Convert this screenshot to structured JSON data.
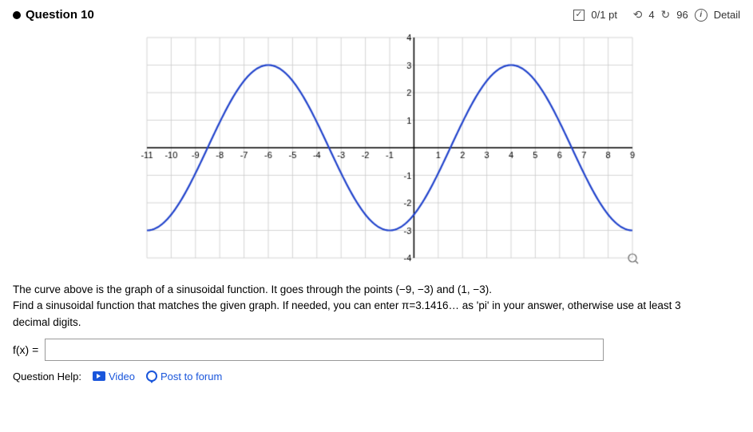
{
  "question": {
    "number": "Question 10",
    "score": "0/1 pt",
    "history_count": "4",
    "redo_count": "96",
    "detail_label": "Detail",
    "description": "The curve above is the graph of a sinusoidal function. It goes through the points (−9, −3) and (1, −3).",
    "description2": "Find a sinusoidal function that matches the given graph. If needed, you can enter π=3.1416… as 'pi' in your answer, otherwise use at least 3 decimal digits.",
    "function_label": "f(x) =",
    "function_placeholder": "",
    "help_label": "Question Help:",
    "video_label": "Video",
    "forum_label": "Post to forum"
  },
  "graph": {
    "x_min": -11,
    "x_max": 9,
    "y_min": -4,
    "y_max": 4
  }
}
